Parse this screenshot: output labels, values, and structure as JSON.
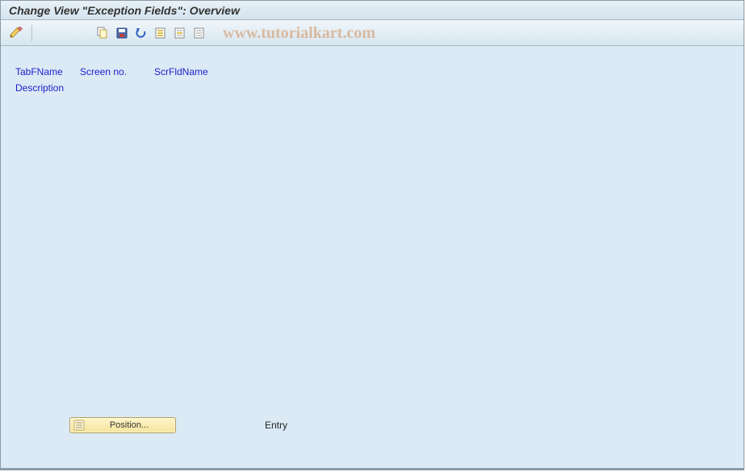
{
  "title": "Change View \"Exception Fields\": Overview",
  "watermark": "www.tutorialkart.com",
  "toolbar": {
    "icons": {
      "pencil": "pencil-icon",
      "copy": "copy-icon",
      "save": "save-icon",
      "undo": "undo-icon",
      "select_all": "select-all-icon",
      "select_block": "select-block-icon",
      "deselect": "deselect-icon"
    }
  },
  "columns": {
    "tabfname": "TabFName",
    "screenno": "Screen no.",
    "scrfldname": "ScrFldName",
    "description": "Description"
  },
  "footer": {
    "position_label": "Position...",
    "entry_label": "Entry"
  }
}
